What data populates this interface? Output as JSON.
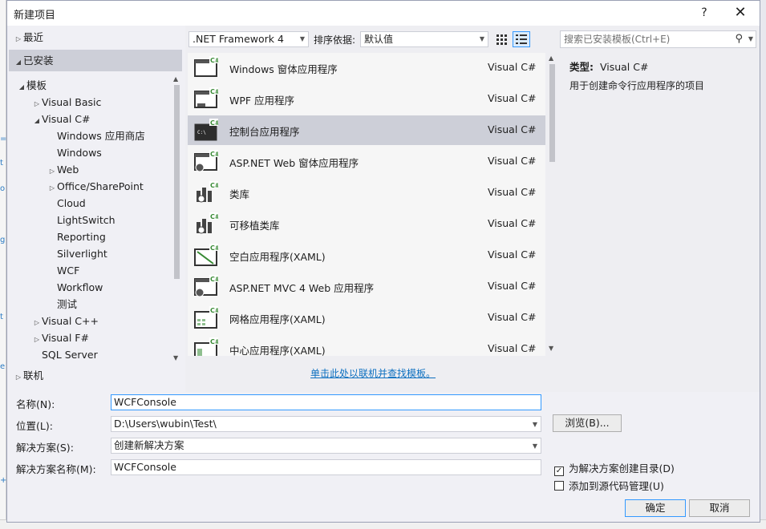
{
  "dialog": {
    "title": "新建项目",
    "help": "?",
    "close": "✕"
  },
  "left_panel": {
    "recent": "最近",
    "installed": "已安装",
    "online": "联机",
    "tree": [
      {
        "label": "模板",
        "level": 0,
        "expander": "expanded"
      },
      {
        "label": "Visual Basic",
        "level": 1,
        "expander": "collapsed"
      },
      {
        "label": "Visual C#",
        "level": 1,
        "expander": "expanded"
      },
      {
        "label": "Windows 应用商店",
        "level": 2,
        "expander": "none"
      },
      {
        "label": "Windows",
        "level": 2,
        "expander": "none"
      },
      {
        "label": "Web",
        "level": 2,
        "expander": "collapsed"
      },
      {
        "label": "Office/SharePoint",
        "level": 2,
        "expander": "collapsed"
      },
      {
        "label": "Cloud",
        "level": 2,
        "expander": "none"
      },
      {
        "label": "LightSwitch",
        "level": 2,
        "expander": "none"
      },
      {
        "label": "Reporting",
        "level": 2,
        "expander": "none"
      },
      {
        "label": "Silverlight",
        "level": 2,
        "expander": "none"
      },
      {
        "label": "WCF",
        "level": 2,
        "expander": "none"
      },
      {
        "label": "Workflow",
        "level": 2,
        "expander": "none"
      },
      {
        "label": "测试",
        "level": 2,
        "expander": "none"
      },
      {
        "label": "Visual C++",
        "level": 1,
        "expander": "collapsed"
      },
      {
        "label": "Visual F#",
        "level": 1,
        "expander": "collapsed"
      },
      {
        "label": "SQL Server",
        "level": 1,
        "expander": "none"
      }
    ]
  },
  "toolbar": {
    "framework": ".NET Framework 4",
    "sort_label": "排序依据:",
    "sort_value": "默认值",
    "search_placeholder": "搜索已安装模板(Ctrl+E)"
  },
  "templates": [
    {
      "name": "Windows 窗体应用程序",
      "lang": "Visual C#",
      "icon": "winforms-icon",
      "selected": false
    },
    {
      "name": "WPF 应用程序",
      "lang": "Visual C#",
      "icon": "wpf-icon",
      "selected": false
    },
    {
      "name": "控制台应用程序",
      "lang": "Visual C#",
      "icon": "console-icon",
      "selected": true
    },
    {
      "name": "ASP.NET Web 窗体应用程序",
      "lang": "Visual C#",
      "icon": "aspnet-icon",
      "selected": false
    },
    {
      "name": "类库",
      "lang": "Visual C#",
      "icon": "class-library-icon",
      "selected": false
    },
    {
      "name": "可移植类库",
      "lang": "Visual C#",
      "icon": "portable-library-icon",
      "selected": false
    },
    {
      "name": "空白应用程序(XAML)",
      "lang": "Visual C#",
      "icon": "blank-app-icon",
      "selected": false
    },
    {
      "name": "ASP.NET MVC 4 Web 应用程序",
      "lang": "Visual C#",
      "icon": "mvc-icon",
      "selected": false
    },
    {
      "name": "网格应用程序(XAML)",
      "lang": "Visual C#",
      "icon": "grid-app-icon",
      "selected": false
    },
    {
      "name": "中心应用程序(XAML)",
      "lang": "Visual C#",
      "icon": "hub-app-icon",
      "selected": false
    }
  ],
  "description": {
    "type_label": "类型:",
    "type_value": "Visual C#",
    "text": "用于创建命令行应用程序的项目"
  },
  "online_link": "单击此处以联机并查找模板。",
  "form": {
    "name_label": "名称(N):",
    "name_value": "WCFConsole",
    "location_label": "位置(L):",
    "location_value": "D:\\Users\\wubin\\Test\\",
    "solution_label": "解决方案(S):",
    "solution_value": "创建新解决方案",
    "solution_name_label": "解决方案名称(M):",
    "solution_name_value": "WCFConsole",
    "browse": "浏览(B)...",
    "create_dir_label": "为解决方案创建目录(D)",
    "create_dir_checked": true,
    "add_source_control_label": "添加到源代码管理(U)",
    "add_source_control_checked": false,
    "ok": "确定",
    "cancel": "取消"
  },
  "colors": {
    "selection": "#cdcfd8",
    "accent": "#3399ff",
    "link": "#0e70c0",
    "csharp_green": "#388a34"
  }
}
